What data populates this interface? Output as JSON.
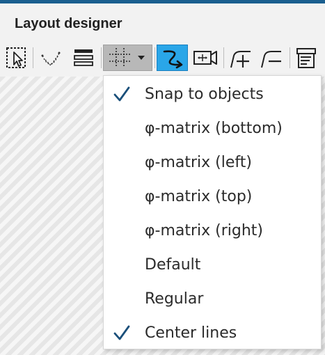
{
  "window": {
    "title": "Layout designer"
  },
  "toolbar": {
    "buttons": [
      {
        "icon": "selection-arrow-icon",
        "active": false
      },
      {
        "icon": "curve-points-icon",
        "active": false
      },
      {
        "icon": "align-bars-icon",
        "active": false
      },
      {
        "icon": "snap-grid-icon",
        "active": false,
        "has_dropdown": true
      },
      {
        "icon": "curve-path-icon",
        "active": true
      },
      {
        "icon": "camera-move-icon",
        "active": false
      },
      {
        "icon": "add-keyframe-icon",
        "active": false
      },
      {
        "icon": "remove-keyframe-icon",
        "active": false
      },
      {
        "icon": "properties-icon",
        "active": false
      }
    ]
  },
  "menu": {
    "items": [
      {
        "label": "Snap to objects",
        "checked": true
      },
      {
        "label": "φ-matrix (bottom)",
        "checked": false
      },
      {
        "label": "φ-matrix (left)",
        "checked": false
      },
      {
        "label": "φ-matrix (top)",
        "checked": false
      },
      {
        "label": "φ-matrix (right)",
        "checked": false
      },
      {
        "label": "Default",
        "checked": false
      },
      {
        "label": "Regular",
        "checked": false
      },
      {
        "label": "Center lines",
        "checked": true
      }
    ]
  },
  "colors": {
    "accent": "#2aa6e8",
    "check": "#1a4f7a",
    "topbar": "#1a5f8f"
  }
}
